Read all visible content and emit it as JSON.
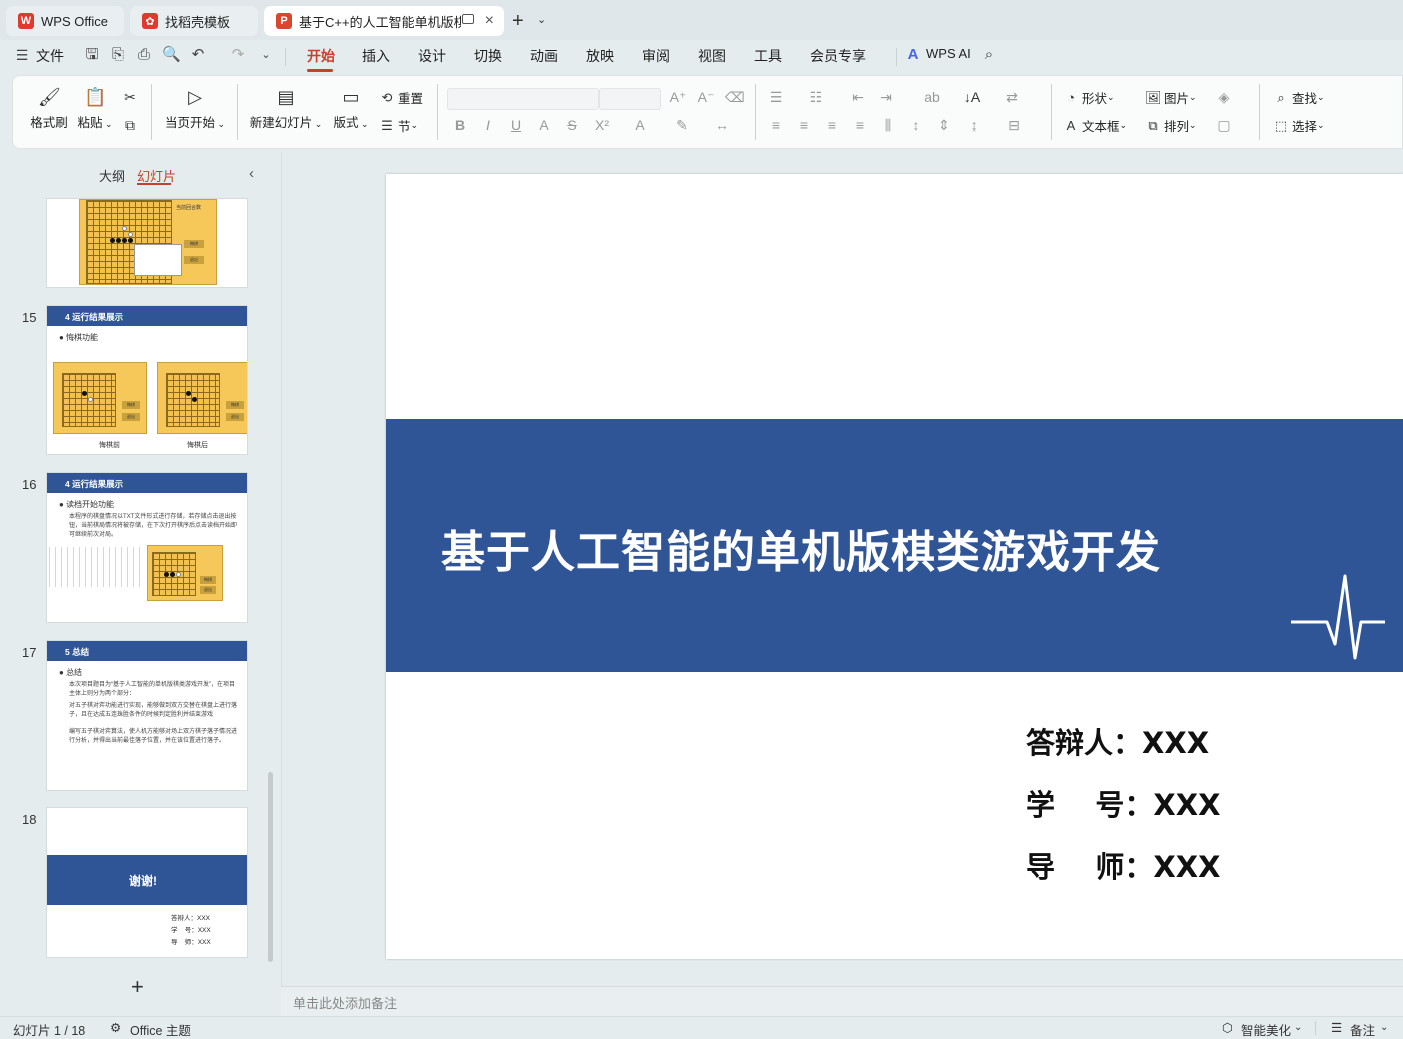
{
  "tabs": [
    {
      "label": "WPS Office",
      "icon": "wps-logo-icon"
    },
    {
      "label": "找稻壳模板",
      "icon": "daoke-logo-icon"
    },
    {
      "label": "基于C++的人工智能单机版棋",
      "icon": "presentation-logo-icon"
    }
  ],
  "menu": {
    "file": "文件",
    "items": [
      "开始",
      "插入",
      "设计",
      "切换",
      "动画",
      "放映",
      "审阅",
      "视图",
      "工具",
      "会员专享"
    ],
    "active": "开始",
    "wps_ai": "WPS AI"
  },
  "ribbon": {
    "format_painter": "格式刷",
    "paste": "粘贴",
    "current_start": "当页开始",
    "new_slide": "新建幻灯片",
    "layout": "版式",
    "section": "节",
    "reset": "重置",
    "shape": "形状",
    "picture": "图片",
    "textbox": "文本框",
    "arrange": "排列",
    "find": "查找",
    "select": "选择"
  },
  "panel": {
    "outline_tab": "大纲",
    "slides_tab": "幻灯片",
    "thumbnails": [
      {
        "num": "15",
        "header": "4 运行结果展示",
        "bullet": "悔棋功能",
        "captions": [
          "悔棋前",
          "悔棋后"
        ]
      },
      {
        "num": "16",
        "header": "4 运行结果展示",
        "bullet": "读档开始功能",
        "text": "本程序的棋盘情况以TXT文件形式进行存储，若存储点击退出按钮，当前棋局情况将被存储，在下次打开棋序后点击读档开始即可继续前次对局。"
      },
      {
        "num": "17",
        "header": "5  总结",
        "bullet": "总结",
        "text1": "本次项目题目为“基于人工智能的单机版棋类游戏开发”，在项目主体上则分为两个部分：",
        "text2": "对五子棋对弈功能进行实现，能够做到双方交替在棋盘上进行落子，且在达成五连珠胜条件的时候判定胜利并结束游戏",
        "text3": "编写五子棋对弈算法，使人机方能够对场上双方棋子落子情况进行分析，并得出当前最佳落子位置，并在该位置进行落子。"
      },
      {
        "num": "18",
        "title": "谢谢!",
        "lines": [
          "答辩人：XXX",
          "学    号：XXX",
          "导    师：XXX"
        ]
      }
    ],
    "board_labels": {
      "title": "五子棋",
      "round": "当前回合数",
      "round_val": "8",
      "undo": "悔棋",
      "quit": "退出"
    }
  },
  "slide": {
    "title": "基于人工智能的单机版棋类游戏开发",
    "lines": [
      "答辩人：XXX",
      "学    号：XXX",
      "导    师：XXX"
    ],
    "band_color": "#2f5597"
  },
  "notes_placeholder": "单击此处添加备注",
  "status": {
    "slide_count": "幻灯片 1 / 18",
    "theme": "Office 主题",
    "beautify": "智能美化",
    "notes": "备注"
  },
  "colors": {
    "accent": "#c7402a",
    "slide_blue": "#2f5597",
    "board": "#f6c85a"
  }
}
